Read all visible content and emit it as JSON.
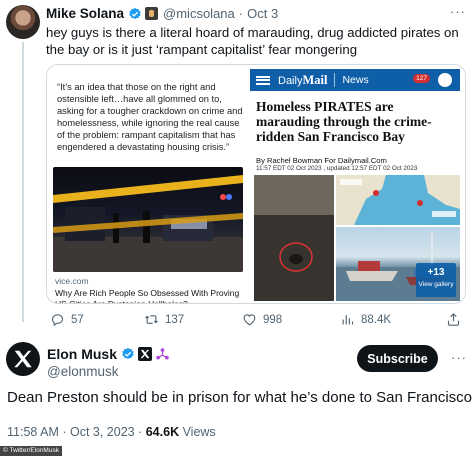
{
  "quoted_tweet": {
    "author_name": "Mike Solana",
    "handle": "@micsolana",
    "separator": "·",
    "date": "Oct 3",
    "more": "···",
    "text": "hey guys is there a literal hoard of marauding, drug addicted pirates on the bay or is it just ‘rampant capitalist’ fear mongering",
    "card": {
      "vice": {
        "quote": "“It’s an idea that those on the right and ostensible left…have all glommed on to, asking for a tougher crackdown on crime and homelessness, while ignoring the real cause of the problem: rampant capitalism that has engendered a devastating housing crisis.”",
        "domain": "vice.com",
        "title": "Why Are Rich People So Obsessed With Proving US Cities Are Dystopian Hellholes?"
      },
      "dailymail": {
        "logo_prefix": "Daily",
        "logo_main": "Mail",
        "section": "News",
        "badge": "127",
        "headline": "Homeless PIRATES are marauding through the crime-ridden San Francisco Bay",
        "byline": "By Rachel Bowman For Dailymail.Com",
        "date": "11:57 EDT 02 Oct 2023 , updated 12:57 EDT 02 Oct 2023",
        "gallery_count": "+13",
        "gallery_label": "View gallery"
      }
    },
    "actions": {
      "replies": "57",
      "retweets": "137",
      "likes": "998",
      "views": "88.4K"
    }
  },
  "main_tweet": {
    "author_name": "Elon Musk",
    "handle": "@elonmusk",
    "follow_label": "Subscribe",
    "more": "···",
    "text": "Dean Preston should be in prison for what he’s done to San Francisco",
    "time": "11:58 AM · Oct 3, 2023 · ",
    "views_count": "64.6K",
    "views_label": " Views"
  },
  "watermark": "© Twitter/ElonMusk",
  "colors": {
    "verified": "#1d9bf0",
    "dailymail_blue": "#0e5fa8",
    "text_secondary": "#536471"
  }
}
